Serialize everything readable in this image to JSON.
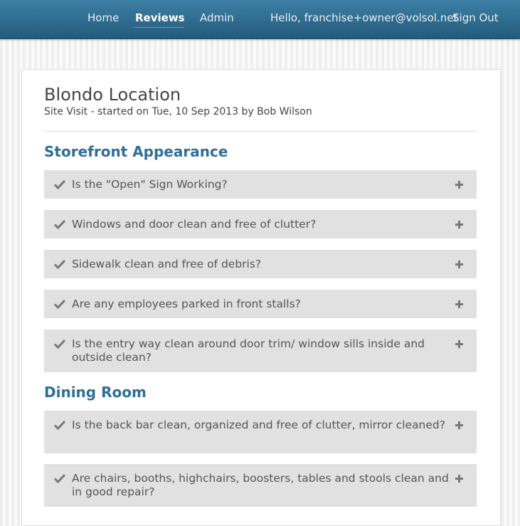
{
  "nav": {
    "home": "Home",
    "reviews": "Reviews",
    "admin": "Admin",
    "hello": "Hello,  franchise+owner@volsol.net",
    "signout": "Sign Out"
  },
  "location": {
    "title": "Blondo Location",
    "subtitle": "Site Visit - started on Tue, 10 Sep 2013 by Bob Wilson"
  },
  "sections": [
    {
      "heading": "Storefront Appearance",
      "items": [
        "Is the \"Open\" Sign Working?",
        "Windows and door clean and free of clutter?",
        "Sidewalk clean and free of debris?",
        "Are any employees parked in front stalls?",
        "Is the entry way clean around door trim/ window sills inside and outside clean?"
      ]
    },
    {
      "heading": "Dining Room",
      "items": [
        "Is the back bar clean, organized and free of clutter, mirror cleaned?",
        "Are chairs, booths, highchairs, boosters, tables and stools clean and in good repair?"
      ]
    }
  ],
  "icons": {
    "check": "checkmark-icon",
    "expand": "plus-icon"
  },
  "colors": {
    "header": "#2f6f96",
    "accent": "#2f6f96",
    "item_bg": "#e1e1e1"
  }
}
